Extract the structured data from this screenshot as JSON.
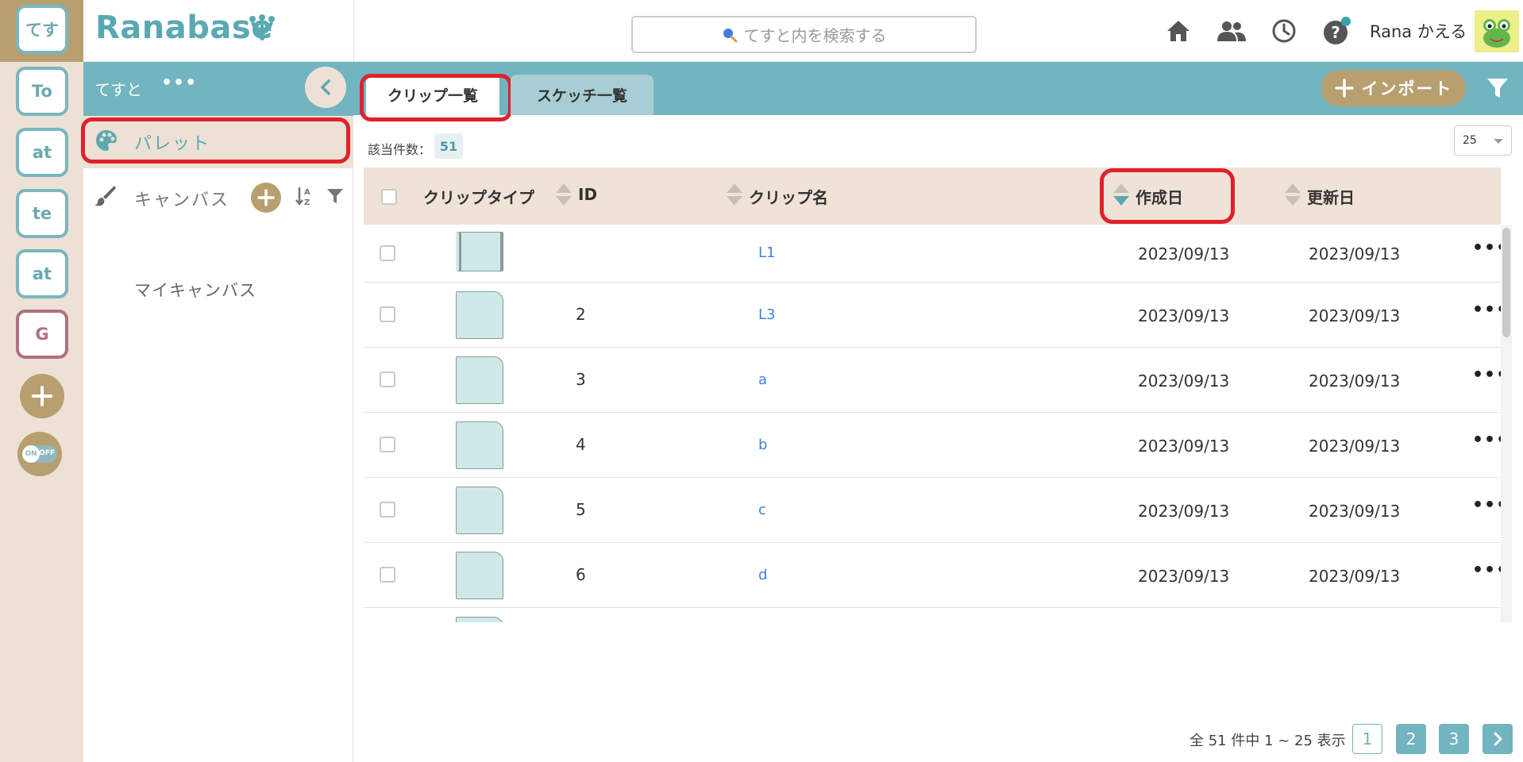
{
  "rail": {
    "workspaces": [
      {
        "label": "てす"
      },
      {
        "label": "To"
      },
      {
        "label": "at"
      },
      {
        "label": "te"
      },
      {
        "label": "at"
      },
      {
        "label": "G"
      }
    ],
    "toggle_on": "ON",
    "toggle_off": "OFF"
  },
  "header": {
    "logo": "Ranabase",
    "search_placeholder": "てすと内を検索する",
    "user_name": "Rana かえる"
  },
  "panel": {
    "title": "てすと",
    "more": "•••",
    "palette_label": "パレット",
    "canvas_label": "キャンバス",
    "my_canvas": "マイキャンバス"
  },
  "tabs": {
    "clip_list": "クリップ一覧",
    "sketch_list": "スケッチ一覧"
  },
  "toolbar": {
    "import_label": "インポート",
    "count_label": "該当件数：",
    "count_value": "51",
    "per_page": "25"
  },
  "table": {
    "columns": {
      "clip_type": "クリップタイプ",
      "id": "ID",
      "clip_name": "クリップ名",
      "created": "作成日",
      "updated": "更新日"
    },
    "rows": [
      {
        "id": "",
        "name": "L1",
        "created": "2023/09/13",
        "updated": "2023/09/13"
      },
      {
        "id": "2",
        "name": "L3",
        "created": "2023/09/13",
        "updated": "2023/09/13"
      },
      {
        "id": "3",
        "name": "a",
        "created": "2023/09/13",
        "updated": "2023/09/13"
      },
      {
        "id": "4",
        "name": "b",
        "created": "2023/09/13",
        "updated": "2023/09/13"
      },
      {
        "id": "5",
        "name": "c",
        "created": "2023/09/13",
        "updated": "2023/09/13"
      },
      {
        "id": "6",
        "name": "d",
        "created": "2023/09/13",
        "updated": "2023/09/13"
      }
    ]
  },
  "pagination": {
    "summary": "全 51 件中 1 ~ 25 表示",
    "pages": [
      "1",
      "2",
      "3"
    ],
    "current": "1"
  },
  "colors": {
    "teal": "#72b4bf",
    "gold": "#b89f6f",
    "beige": "#ede1d6",
    "highlight_red": "#e0212b",
    "link_blue": "#3f7fe0"
  }
}
